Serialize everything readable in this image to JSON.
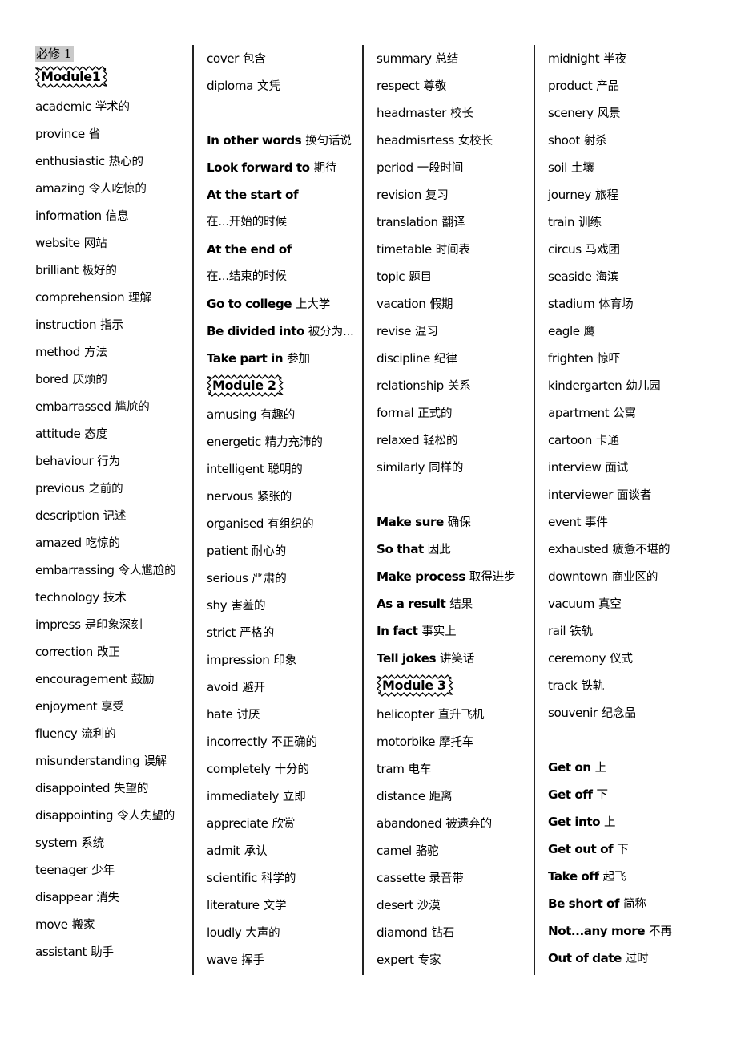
{
  "document": {
    "title_zh": "必修 1",
    "columns": [
      {
        "id": "column-1",
        "heading": {
          "label": "Module1",
          "style": "wavy-box"
        },
        "entries": [
          {
            "en": "academic",
            "zh": "学术的"
          },
          {
            "en": "province",
            "zh": "省"
          },
          {
            "en": "enthusiastic",
            "zh": "热心的"
          },
          {
            "en": "amazing",
            "zh": "令人吃惊的"
          },
          {
            "en": "information",
            "zh": "信息"
          },
          {
            "en": "website",
            "zh": "网站"
          },
          {
            "en": "brilliant",
            "zh": "极好的"
          },
          {
            "en": "comprehension",
            "zh": "理解"
          },
          {
            "en": "instruction",
            "zh": "指示"
          },
          {
            "en": "method",
            "zh": "方法"
          },
          {
            "en": "bored",
            "zh": "厌烦的"
          },
          {
            "en": "embarrassed",
            "zh": "尴尬的"
          },
          {
            "en": "attitude",
            "zh": "态度"
          },
          {
            "en": "behaviour",
            "zh": "行为"
          },
          {
            "en": "previous",
            "zh": "之前的"
          },
          {
            "en": "description",
            "zh": "记述"
          },
          {
            "en": "amazed",
            "zh": "吃惊的"
          },
          {
            "en": "embarrassing",
            "zh": "令人尴尬的"
          },
          {
            "en": "technology",
            "zh": "技术"
          },
          {
            "en": "impress",
            "zh": "是印象深刻"
          },
          {
            "en": "correction",
            "zh": "改正"
          },
          {
            "en": "encouragement",
            "zh": "鼓励"
          },
          {
            "en": "enjoyment",
            "zh": "享受"
          },
          {
            "en": "fluency",
            "zh": "流利的"
          },
          {
            "en": "misunderstanding",
            "zh": "误解"
          },
          {
            "en": "disappointed",
            "zh": "失望的"
          },
          {
            "en": "disappointing",
            "zh": "令人失望的"
          },
          {
            "en": "system",
            "zh": "系统"
          },
          {
            "en": "teenager",
            "zh": "少年"
          },
          {
            "en": "disappear",
            "zh": "消失"
          },
          {
            "en": "move",
            "zh": "搬家"
          },
          {
            "en": "assistant",
            "zh": "助手"
          }
        ]
      },
      {
        "id": "column-2",
        "entries": [
          {
            "en": "cover",
            "zh": "包含"
          },
          {
            "en": "diploma",
            "zh": "文凭"
          },
          {
            "blank": true
          },
          {
            "en": "In other words",
            "zh": "换句话说",
            "phrase": true
          },
          {
            "en": "Look forward to",
            "zh": "期待",
            "phrase": true
          },
          {
            "en": "At the start of",
            "zh": "",
            "phrase": true
          },
          {
            "zh_only": "在...开始的时候"
          },
          {
            "en": "At the end of",
            "zh": "",
            "phrase": true
          },
          {
            "zh_only": "在...结束的时候"
          },
          {
            "en": "Go to college",
            "zh": "上大学",
            "phrase": true
          },
          {
            "en": "Be divided into",
            "zh": "被分为...",
            "phrase": true
          },
          {
            "en": "Take part in",
            "zh": "参加",
            "phrase": true
          },
          {
            "module": "Module 2"
          },
          {
            "en": "amusing",
            "zh": "有趣的"
          },
          {
            "en": "energetic",
            "zh": "精力充沛的"
          },
          {
            "en": "intelligent",
            "zh": "聪明的"
          },
          {
            "en": "nervous",
            "zh": "紧张的"
          },
          {
            "en": "organised",
            "zh": "有组织的"
          },
          {
            "en": "patient",
            "zh": "耐心的"
          },
          {
            "en": "serious",
            "zh": "严肃的"
          },
          {
            "en": "shy",
            "zh": "害羞的"
          },
          {
            "en": "strict",
            "zh": "严格的"
          },
          {
            "en": "impression",
            "zh": "印象"
          },
          {
            "en": "avoid",
            "zh": "避开"
          },
          {
            "en": "hate",
            "zh": "讨厌"
          },
          {
            "en": "incorrectly",
            "zh": "不正确的"
          },
          {
            "en": "completely",
            "zh": "十分的"
          },
          {
            "en": "immediately",
            "zh": "立即"
          },
          {
            "en": "appreciate",
            "zh": "欣赏"
          },
          {
            "en": "admit",
            "zh": "承认"
          },
          {
            "en": "scientific",
            "zh": "科学的"
          },
          {
            "en": "literature",
            "zh": "文学"
          },
          {
            "en": "loudly",
            "zh": "大声的"
          },
          {
            "en": "wave",
            "zh": "挥手"
          }
        ]
      },
      {
        "id": "column-3",
        "entries": [
          {
            "en": "summary",
            "zh": "总结"
          },
          {
            "en": "respect",
            "zh": "尊敬"
          },
          {
            "en": "headmaster",
            "zh": "校长"
          },
          {
            "en": "headmisrtess",
            "zh": "女校长"
          },
          {
            "en": "period",
            "zh": "一段时间"
          },
          {
            "en": "revision",
            "zh": "复习"
          },
          {
            "en": "translation",
            "zh": "翻译"
          },
          {
            "en": "timetable",
            "zh": "时间表"
          },
          {
            "en": "topic",
            "zh": "题目"
          },
          {
            "en": "vacation",
            "zh": "假期"
          },
          {
            "en": "revise",
            "zh": "温习"
          },
          {
            "en": "discipline",
            "zh": "纪律"
          },
          {
            "en": "relationship",
            "zh": "关系"
          },
          {
            "en": "formal",
            "zh": "正式的"
          },
          {
            "en": "relaxed",
            "zh": "轻松的"
          },
          {
            "en": "similarly",
            "zh": "同样的"
          },
          {
            "blank": true
          },
          {
            "en": "Make sure",
            "zh": "确保",
            "phrase": true
          },
          {
            "en": "So that",
            "zh": "因此",
            "phrase": true
          },
          {
            "en": "Make process",
            "zh": "取得进步",
            "phrase": true
          },
          {
            "en": "As a result",
            "zh": "结果",
            "phrase": true
          },
          {
            "en": "In fact",
            "zh": "事实上",
            "phrase": true
          },
          {
            "en": "Tell jokes",
            "zh": "讲笑话",
            "phrase": true
          },
          {
            "module": "Module 3"
          },
          {
            "en": "helicopter",
            "zh": "直升飞机"
          },
          {
            "en": "motorbike",
            "zh": "摩托车"
          },
          {
            "en": "tram",
            "zh": "电车"
          },
          {
            "en": "distance",
            "zh": "距离"
          },
          {
            "en": "abandoned",
            "zh": "被遗弃的"
          },
          {
            "en": "camel",
            "zh": "骆驼"
          },
          {
            "en": "cassette",
            "zh": "录音带"
          },
          {
            "en": "desert",
            "zh": "沙漠"
          },
          {
            "en": "diamond",
            "zh": "钻石"
          },
          {
            "en": "expert",
            "zh": "专家"
          }
        ]
      },
      {
        "id": "column-4",
        "entries": [
          {
            "en": "midnight",
            "zh": "半夜"
          },
          {
            "en": "product",
            "zh": "产品"
          },
          {
            "en": "scenery",
            "zh": "风景"
          },
          {
            "en": "shoot",
            "zh": "射杀"
          },
          {
            "en": "soil",
            "zh": "土壤"
          },
          {
            "en": "journey",
            "zh": "旅程"
          },
          {
            "en": "train",
            "zh": "训练"
          },
          {
            "en": "circus",
            "zh": "马戏团"
          },
          {
            "en": "seaside",
            "zh": "海滨"
          },
          {
            "en": "stadium",
            "zh": "体育场"
          },
          {
            "en": "eagle",
            "zh": "鹰"
          },
          {
            "en": "frighten",
            "zh": "惊吓"
          },
          {
            "en": "kindergarten",
            "zh": "幼儿园"
          },
          {
            "en": "apartment",
            "zh": "公寓"
          },
          {
            "en": "cartoon",
            "zh": "卡通"
          },
          {
            "en": "interview",
            "zh": "面试"
          },
          {
            "en": "interviewer",
            "zh": "面谈者"
          },
          {
            "en": "event",
            "zh": "事件"
          },
          {
            "en": "exhausted",
            "zh": "疲惫不堪的"
          },
          {
            "en": "downtown",
            "zh": "商业区的"
          },
          {
            "en": "vacuum",
            "zh": "真空"
          },
          {
            "en": "rail",
            "zh": "铁轨"
          },
          {
            "en": "ceremony",
            "zh": "仪式"
          },
          {
            "en": "track",
            "zh": "铁轨"
          },
          {
            "en": "souvenir",
            "zh": "纪念品"
          },
          {
            "blank": true
          },
          {
            "en": "Get on",
            "zh": "上",
            "phrase": true
          },
          {
            "en": "Get off",
            "zh": "下",
            "phrase": true
          },
          {
            "en": "Get into",
            "zh": "上",
            "phrase": true
          },
          {
            "en": "Get out of",
            "zh": "下",
            "phrase": true
          },
          {
            "en": "Take off",
            "zh": "起飞",
            "phrase": true
          },
          {
            "en": "Be short of",
            "zh": "简称",
            "phrase": true
          },
          {
            "en": "Not...any more",
            "zh": "不再",
            "phrase": true
          },
          {
            "en": "Out of date",
            "zh": "过时",
            "phrase": true
          }
        ]
      }
    ]
  }
}
